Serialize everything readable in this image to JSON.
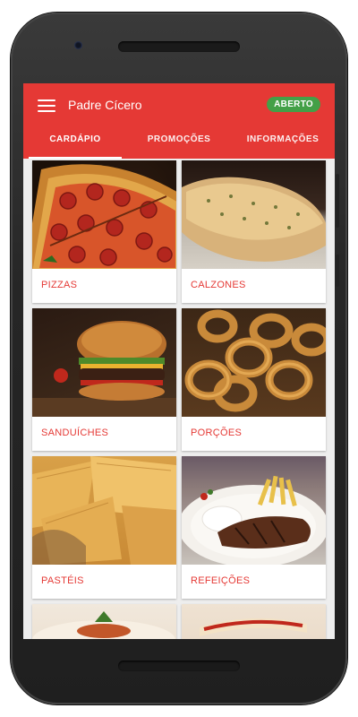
{
  "app": {
    "title": "Padre Cícero",
    "status_badge": "ABERTO",
    "colors": {
      "primary": "#e53935",
      "status_open": "#43a047"
    }
  },
  "tabs": [
    {
      "label": "CARDÁPIO",
      "active": true
    },
    {
      "label": "PROMOÇÕES",
      "active": false
    },
    {
      "label": "INFORMAÇÕES",
      "active": false
    }
  ],
  "categories": [
    {
      "label": "PIZZAS",
      "image": "pizza"
    },
    {
      "label": "CALZONES",
      "image": "calzone"
    },
    {
      "label": "SANDUÍCHES",
      "image": "burger"
    },
    {
      "label": "PORÇÕES",
      "image": "onion-rings"
    },
    {
      "label": "PASTÉIS",
      "image": "pastel"
    },
    {
      "label": "REFEIÇÕES",
      "image": "steak-meal"
    }
  ],
  "icons": {
    "menu": "hamburger-menu-icon"
  }
}
